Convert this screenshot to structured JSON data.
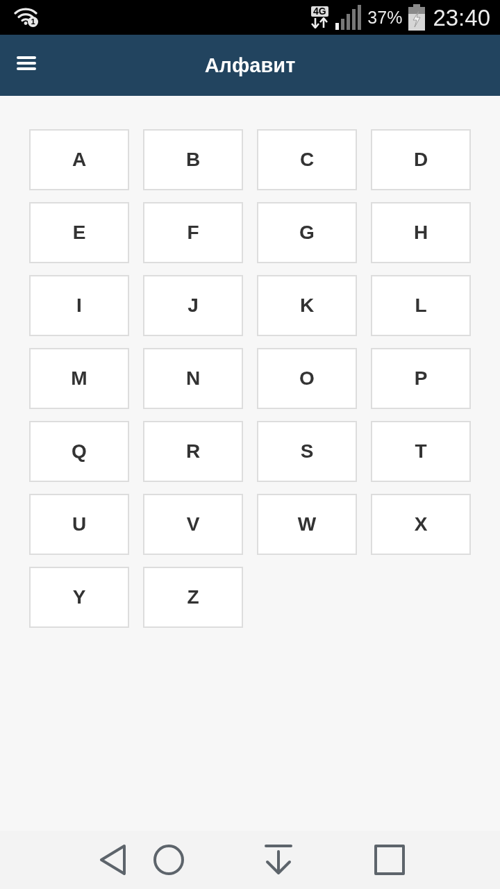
{
  "status_bar": {
    "wifi_badge": "1",
    "network_badge": "4G",
    "battery": "37%",
    "time": "23:40"
  },
  "app_bar": {
    "title": "Алфавит"
  },
  "letters": [
    "A",
    "B",
    "C",
    "D",
    "E",
    "F",
    "G",
    "H",
    "I",
    "J",
    "K",
    "L",
    "M",
    "N",
    "O",
    "P",
    "Q",
    "R",
    "S",
    "T",
    "U",
    "V",
    "W",
    "X",
    "Y",
    "Z"
  ]
}
